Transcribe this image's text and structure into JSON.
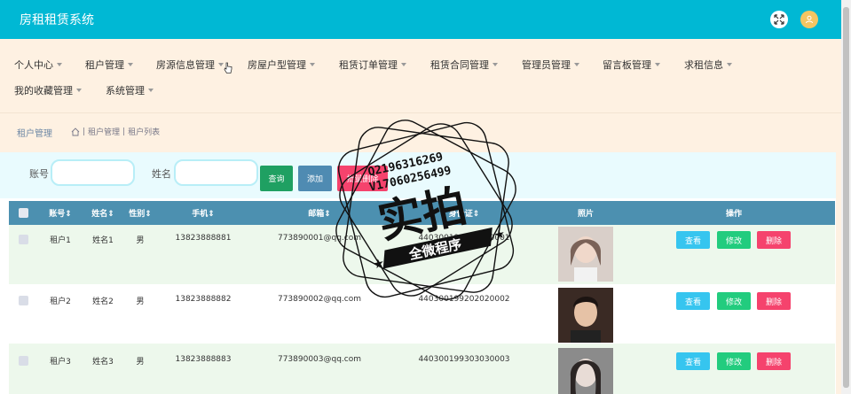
{
  "app": {
    "title": "房租租赁系统"
  },
  "nav": {
    "items": [
      {
        "label": "个人中心"
      },
      {
        "label": "租户管理"
      },
      {
        "label": "房源信息管理"
      },
      {
        "label": "房屋户型管理"
      },
      {
        "label": "租赁订单管理"
      },
      {
        "label": "租赁合同管理"
      },
      {
        "label": "管理员管理"
      },
      {
        "label": "留言板管理"
      },
      {
        "label": "求租信息"
      },
      {
        "label": "我的收藏管理"
      },
      {
        "label": "系统管理"
      }
    ]
  },
  "breadcrumb": {
    "title": "租户管理",
    "path": [
      "租户管理",
      "租户列表"
    ]
  },
  "search": {
    "account_label": "账号",
    "account_value": "",
    "name_label": "姓名",
    "name_value": "",
    "query_label": "查询",
    "add_label": "添加",
    "batch_delete_label": "批量删除"
  },
  "table": {
    "headers": [
      "账号",
      "姓名",
      "性别",
      "手机",
      "邮箱",
      "身份证",
      "照片",
      "操作"
    ],
    "rows": [
      {
        "account": "租户1",
        "name": "姓名1",
        "gender": "男",
        "phone": "13823888881",
        "email": "773890001@qq.com",
        "id_card": "440300199101010001"
      },
      {
        "account": "租户2",
        "name": "姓名2",
        "gender": "男",
        "phone": "13823888882",
        "email": "773890002@qq.com",
        "id_card": "440300199202020002"
      },
      {
        "account": "租户3",
        "name": "姓名3",
        "gender": "男",
        "phone": "13823888883",
        "email": "773890003@qq.com",
        "id_card": "440300199303030003"
      }
    ],
    "actions": {
      "view": "查看",
      "edit": "修改",
      "delete": "删除"
    }
  },
  "watermark": {
    "line1": "Q2196316269",
    "line2": "V17060256499",
    "big": "实拍",
    "banner": "全微程序"
  },
  "colors": {
    "topbar": "#00b8d4",
    "nav_bg": "#fef1e2",
    "table_header": "#4c90b0",
    "view": "#36c5ef",
    "edit": "#22cc7e",
    "delete": "#f5436d"
  }
}
